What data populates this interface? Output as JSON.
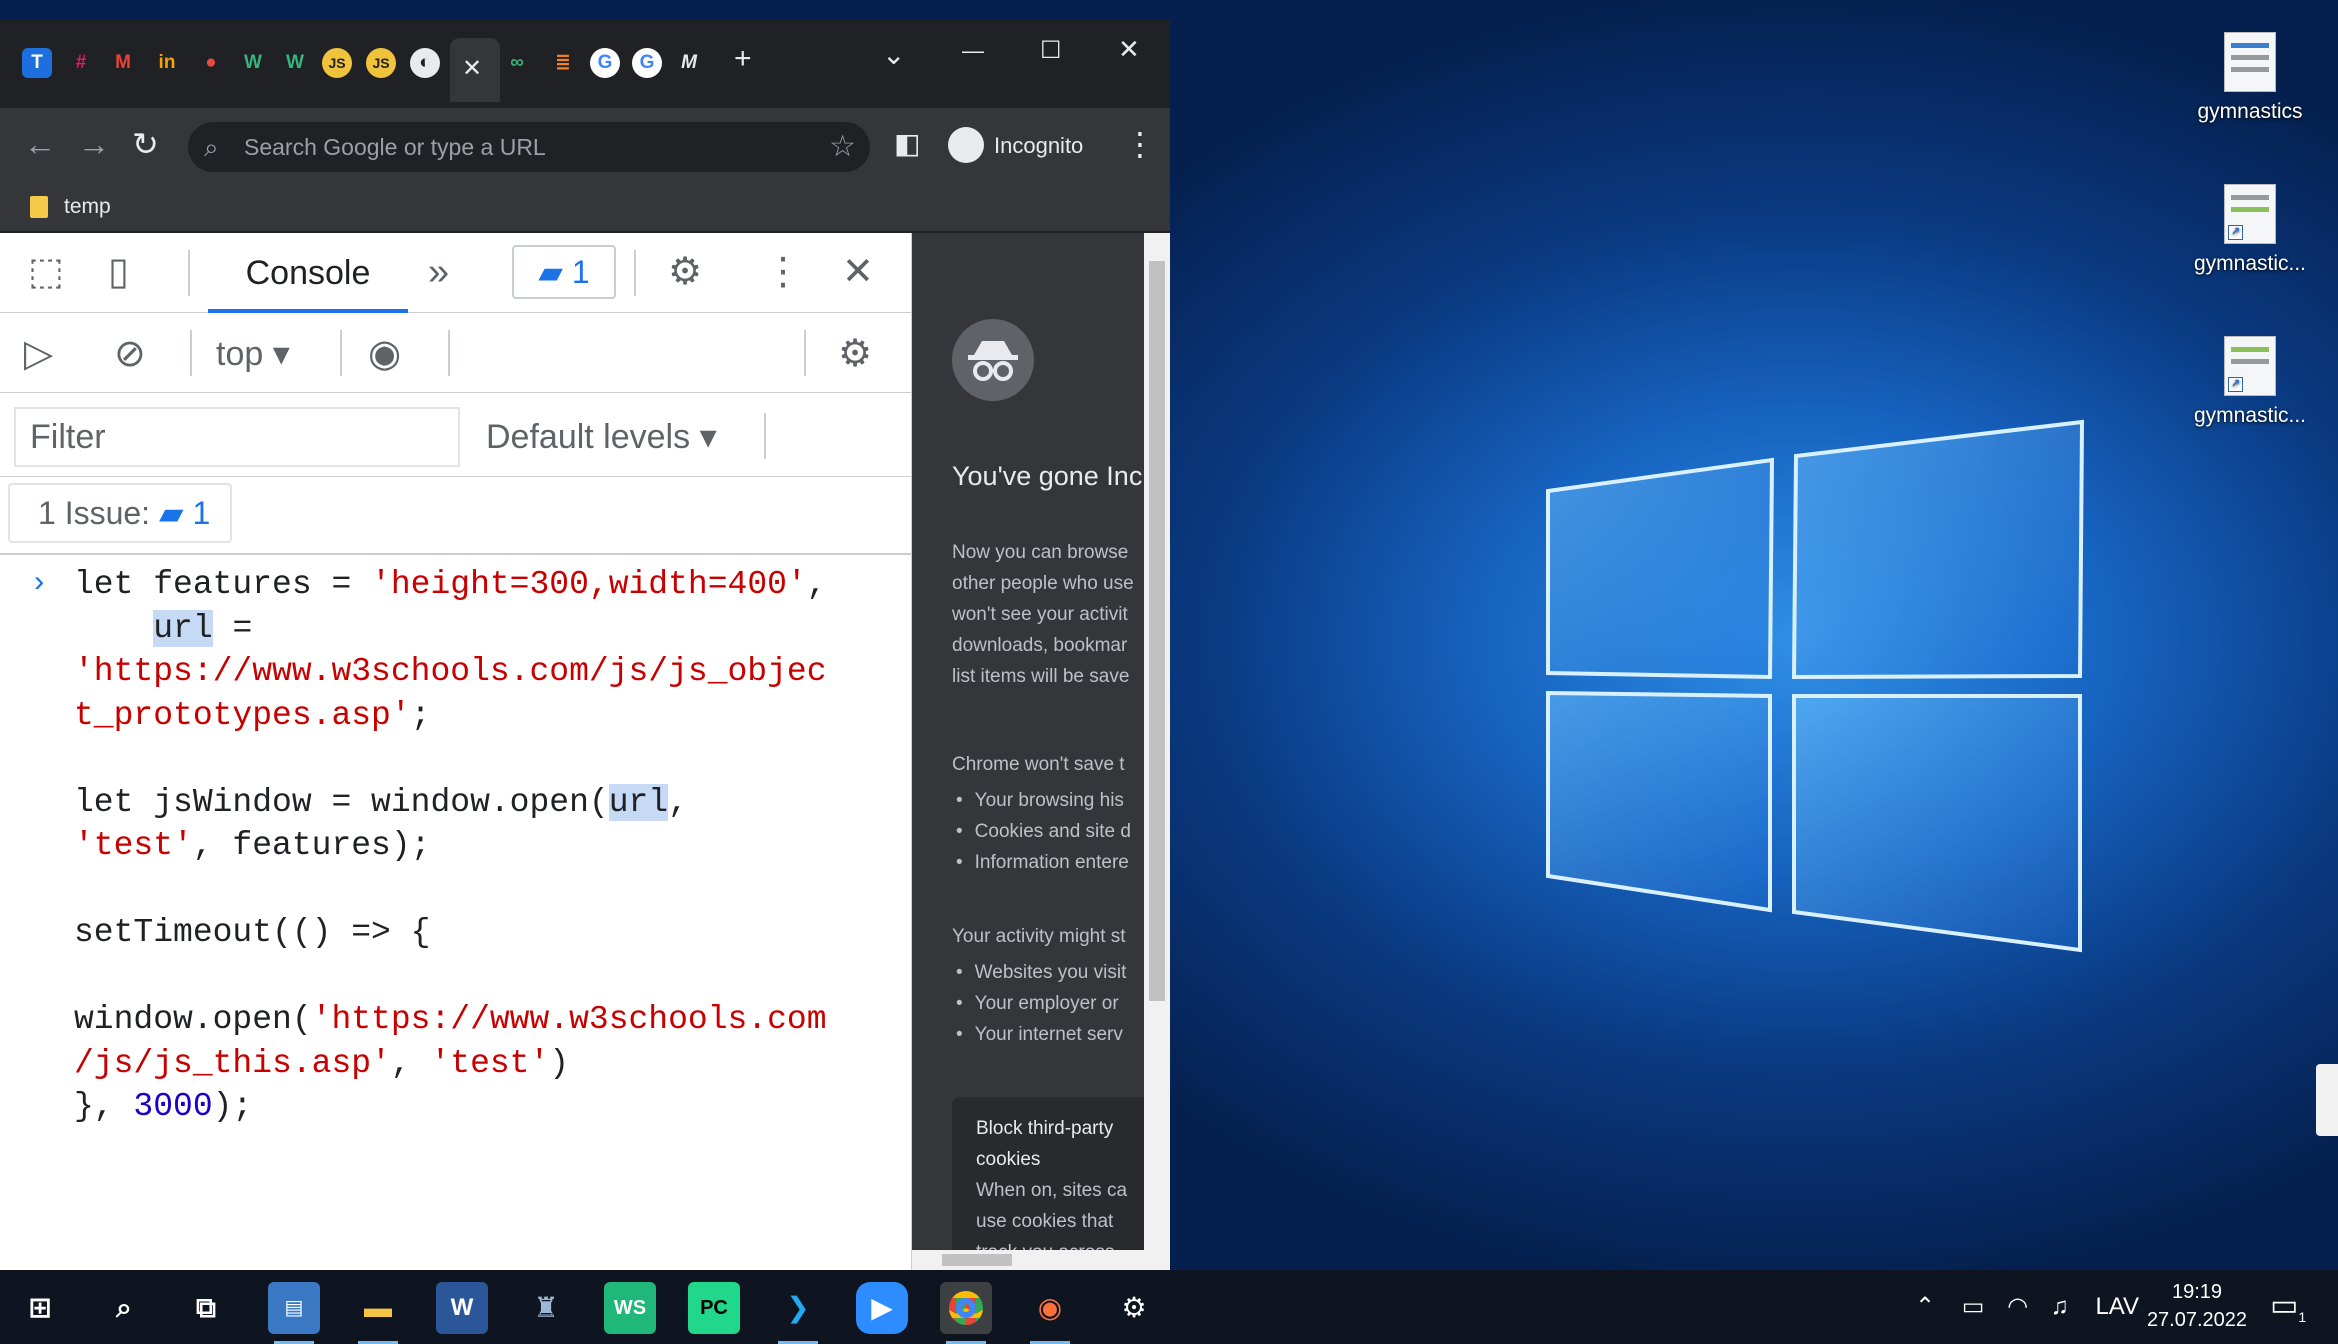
{
  "browser": {
    "window_controls": {
      "dropdown": "⌄",
      "minimize": "—",
      "maximize": "☐",
      "close": "✕"
    },
    "active_tab_close": "✕",
    "new_tab": "+",
    "omnibox_placeholder": "Search Google or type a URL",
    "incognito_label": "Incognito",
    "bookmark": "temp"
  },
  "devtools": {
    "console_tab": "Console",
    "more_tabs": "»",
    "messages_count": "1",
    "context": "top",
    "filter_placeholder": "Filter",
    "levels": "Default levels",
    "issues_label": "1 Issue:",
    "issues_count": "1",
    "prompt": "›"
  },
  "console_code": {
    "l1_kw": "let features = ",
    "l1_str": "'height=300,width=400'",
    "l1_end": ",",
    "l2_pre": "    ",
    "l2_var": "url",
    "l2_end": " =",
    "l3_str": "'https://www.w3schools.com/js/js_objec",
    "l4_str": "t_prototypes.asp'",
    "l4_end": ";",
    "l6_pre": "let jsWindow = window.open(",
    "l6_var": "url",
    "l6_end": ",",
    "l7_str": "'test'",
    "l7_end": ", features);",
    "l9": "setTimeout(() => {",
    "l11_pre": "window.open(",
    "l11_str": "'https://www.w3schools.com",
    "l12_str": "/js/js_this.asp'",
    "l12_mid": ", ",
    "l12_str2": "'test'",
    "l12_end": ")",
    "l13_pre": "}, ",
    "l13_num": "3000",
    "l13_end": ");"
  },
  "incognito_page": {
    "title": "You've gone Inc",
    "p1": [
      "Now you can browse",
      "other people who use",
      "won't see your activit",
      "downloads, bookmar",
      "list items will be save"
    ],
    "h2": "Chrome won't save t",
    "list1": [
      "Your browsing his",
      "Cookies and site d",
      "Information entere"
    ],
    "h3": "Your activity might st",
    "list2": [
      "Websites you visit",
      "Your employer or",
      "Your internet serv"
    ],
    "card_title1": "Block third-party",
    "card_title2": "cookies",
    "card_sub": [
      "When on, sites ca",
      "use cookies that",
      "track you across"
    ]
  },
  "desktop_icons": [
    "gymnastics",
    "gymnastic...",
    "gymnastic..."
  ],
  "taskbar": {
    "tray_language": "LAV",
    "time": "19:19",
    "date": "27.07.2022",
    "notification_count": "1",
    "pinned": [
      "start-icon",
      "search-icon",
      "task-view-icon",
      "control-panel-icon",
      "file-explorer-icon",
      "word-icon",
      "app-icon",
      "webstorm-icon",
      "pycharm-icon",
      "vscode-icon",
      "zoom-icon",
      "chrome-icon",
      "firefox-icon",
      "settings-icon"
    ]
  },
  "colors": {
    "string": "#c80000",
    "number": "#1c00cf",
    "accent": "#1a73e8",
    "chrome_dark": "#202124"
  }
}
